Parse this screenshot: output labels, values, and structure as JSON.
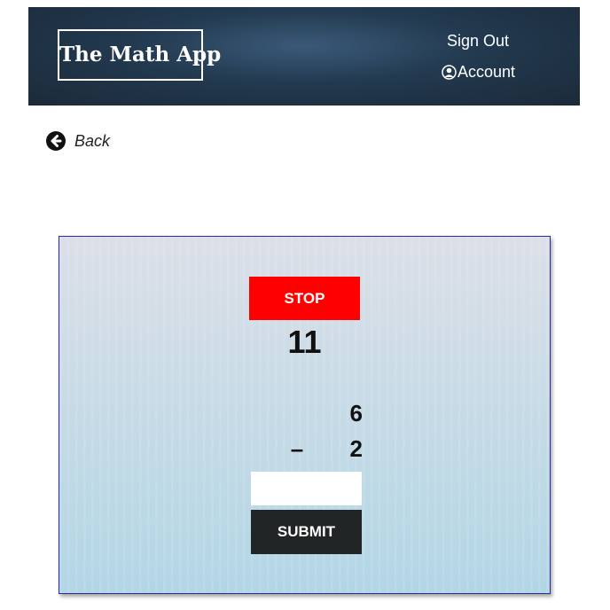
{
  "header": {
    "logo_text": "The Math App",
    "signout_label": "Sign Out",
    "account_label": "Account",
    "background_color": "#22394f"
  },
  "nav": {
    "back_label": "Back"
  },
  "quiz": {
    "stop_label": "STOP",
    "stop_color": "#ff0000",
    "timer_value": "11",
    "operand_top": "6",
    "operator": "–",
    "operand_bottom": "2",
    "answer_value": "",
    "submit_label": "SUBMIT",
    "submit_color": "#222526"
  },
  "icons": {
    "account": "user-circle-icon",
    "back": "arrow-left-circle-icon"
  }
}
